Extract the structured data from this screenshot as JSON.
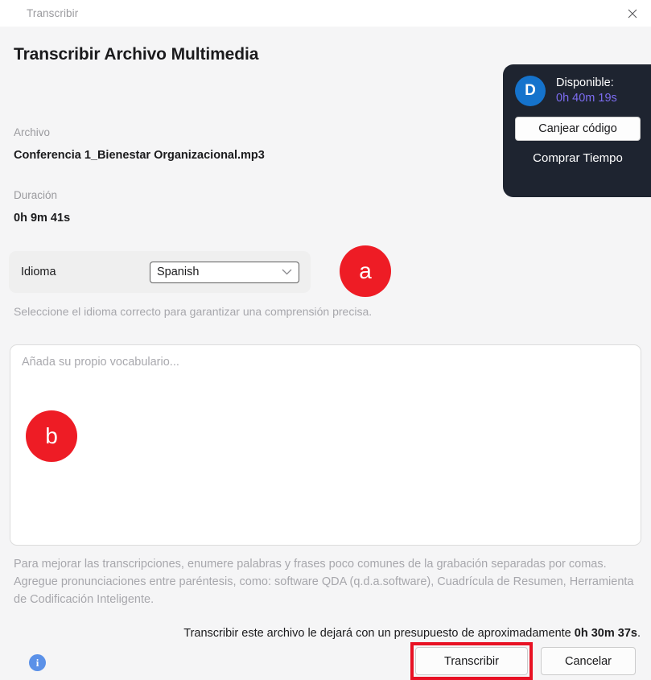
{
  "window": {
    "title": "Transcribir",
    "close_icon": "close-icon"
  },
  "page": {
    "heading": "Transcribir Archivo Multimedia"
  },
  "credit_panel": {
    "avatar_initial": "D",
    "available_label": "Disponible:",
    "available_value": "0h 40m 19s",
    "available_value_color": "#7c6cf0",
    "redeem_label": "Canjear código",
    "buy_time_label": "Comprar Tiempo",
    "panel_color": "#1e2430",
    "avatar_color": "#1573cc"
  },
  "file_info": {
    "file_label": "Archivo",
    "file_value": "Conferencia 1_Bienestar Organizacional.mp3",
    "duration_label": "Duración",
    "duration_value": "0h 9m 41s"
  },
  "language": {
    "label": "Idioma",
    "selected": "Spanish",
    "caret_icon": "chevron-down-icon",
    "hint": "Seleccione el idioma correcto para garantizar una comprensión precisa."
  },
  "vocabulary": {
    "placeholder": "Añada su propio vocabulario...",
    "value": "",
    "help_text": "Para mejorar las transcripciones, enumere palabras y frases poco comunes de la grabación separadas por comas. Agregue pronunciaciones entre paréntesis, como: software QDA (q.d.a.software), Cuadrícula de Resumen, Herramienta de Codificación Inteligente."
  },
  "footer": {
    "budget_prefix": "Transcribir este archivo le dejará con un presupuesto de aproximadamente ",
    "budget_value": "0h 30m 37s",
    "budget_suffix": ".",
    "info_icon": "info-icon",
    "transcribe_label": "Transcribir",
    "cancel_label": "Cancelar",
    "highlight_color": "#e81123"
  },
  "annotations": {
    "marker_a": "a",
    "marker_b": "b",
    "marker_color": "#ee1c25"
  }
}
